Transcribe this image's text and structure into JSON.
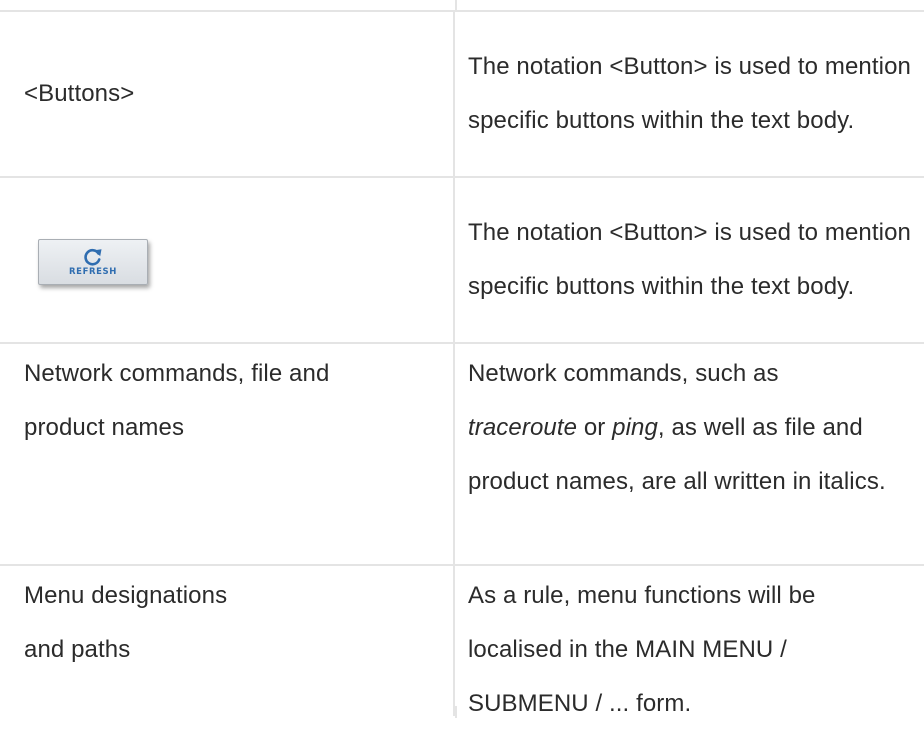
{
  "rows": [
    {
      "left": "<Buttons>",
      "right": "The notation <Button> is used to mention specific buttons within the text body."
    },
    {
      "left_button": {
        "label": "REFRESH",
        "icon": "refresh-icon",
        "color": "#2f6db0"
      },
      "right": "The notation <Button> is used to mention specific buttons within the text body."
    },
    {
      "left_line1": "Network commands, file and",
      "left_line2": "product names",
      "right_prefix": "Network commands, such as ",
      "right_italic1": "traceroute",
      "right_mid": " or ",
      "right_italic2": "ping",
      "right_suffix": ", as well as file and product names, are all written in italics."
    },
    {
      "left_line1": "Menu designations",
      "left_line2": "and paths",
      "right": "As a rule, menu functions will be localised in the MAIN MENU / SUBMENU / ... form."
    }
  ],
  "colors": {
    "border": "#e4e4e4",
    "text": "#2b2b2b"
  }
}
